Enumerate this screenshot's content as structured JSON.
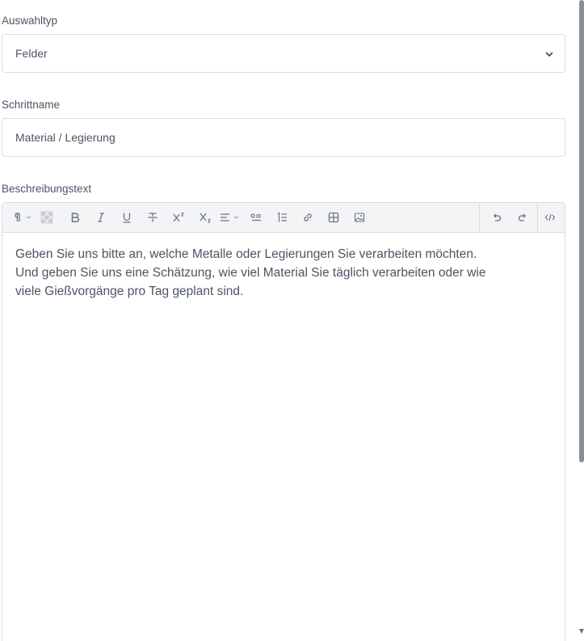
{
  "selection_type": {
    "label": "Auswahltyp",
    "value": "Felder",
    "chevron_icon": "chevron-down-icon"
  },
  "step_name": {
    "label": "Schrittname",
    "value": "Material / Legierung"
  },
  "description": {
    "label": "Beschreibungstext",
    "toolbar_icons": [
      "paragraph-icon",
      "text-color-icon",
      "bold-icon",
      "italic-icon",
      "underline-icon",
      "strikethrough-icon",
      "superscript-icon",
      "subscript-icon",
      "align-icon",
      "bullet-list-icon",
      "numbered-list-icon",
      "link-icon",
      "table-icon",
      "image-icon",
      "undo-icon",
      "redo-icon",
      "code-view-icon"
    ],
    "lines": [
      "Geben Sie uns bitte an, welche Metalle oder Legierungen Sie verarbeiten möchten.",
      "Und geben Sie uns eine Schätzung, wie viel Material Sie täglich verarbeiten oder wie",
      "viele Gießvorgänge pro Tag geplant sind."
    ]
  },
  "colors": {
    "border": "#d9dde3",
    "toolbar_bg": "#f3f4f6",
    "text": "#4b5563"
  }
}
